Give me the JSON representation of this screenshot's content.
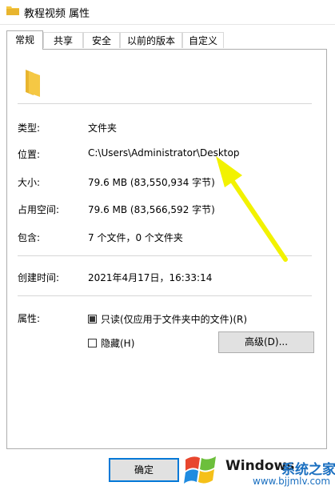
{
  "window": {
    "title": "教程视频 属性"
  },
  "tabs": [
    {
      "label": "常规",
      "active": true
    },
    {
      "label": "共享"
    },
    {
      "label": "安全"
    },
    {
      "label": "以前的版本"
    },
    {
      "label": "自定义"
    }
  ],
  "general": {
    "type_label": "类型:",
    "type_value": "文件夹",
    "location_label": "位置:",
    "location_value": "C:\\Users\\Administrator\\Desktop",
    "size_label": "大小:",
    "size_value": "79.6 MB (83,550,934 字节)",
    "disk_size_label": "占用空间:",
    "disk_size_value": "79.6 MB (83,566,592 字节)",
    "contains_label": "包含:",
    "contains_value": "7 个文件，0 个文件夹",
    "created_label": "创建时间:",
    "created_value": "2021年4月17日，16:33:14",
    "attributes_label": "属性:",
    "readonly_label": "只读(仅应用于文件夹中的文件)(R)",
    "readonly_checked": true,
    "hidden_label": "隐藏(H)",
    "hidden_checked": false,
    "advanced_label": "高级(D)..."
  },
  "footer": {
    "ok_label": "确定"
  },
  "watermark": {
    "brand": "Windows",
    "cn": "系统之家",
    "url": "www.bjjmlv.com"
  },
  "colors": {
    "folder": "#f5c844",
    "arrow": "#f2f200",
    "accent": "#0078d7"
  },
  "icons": [
    "folder-icon",
    "folder-large-icon",
    "windows-logo-icon"
  ]
}
